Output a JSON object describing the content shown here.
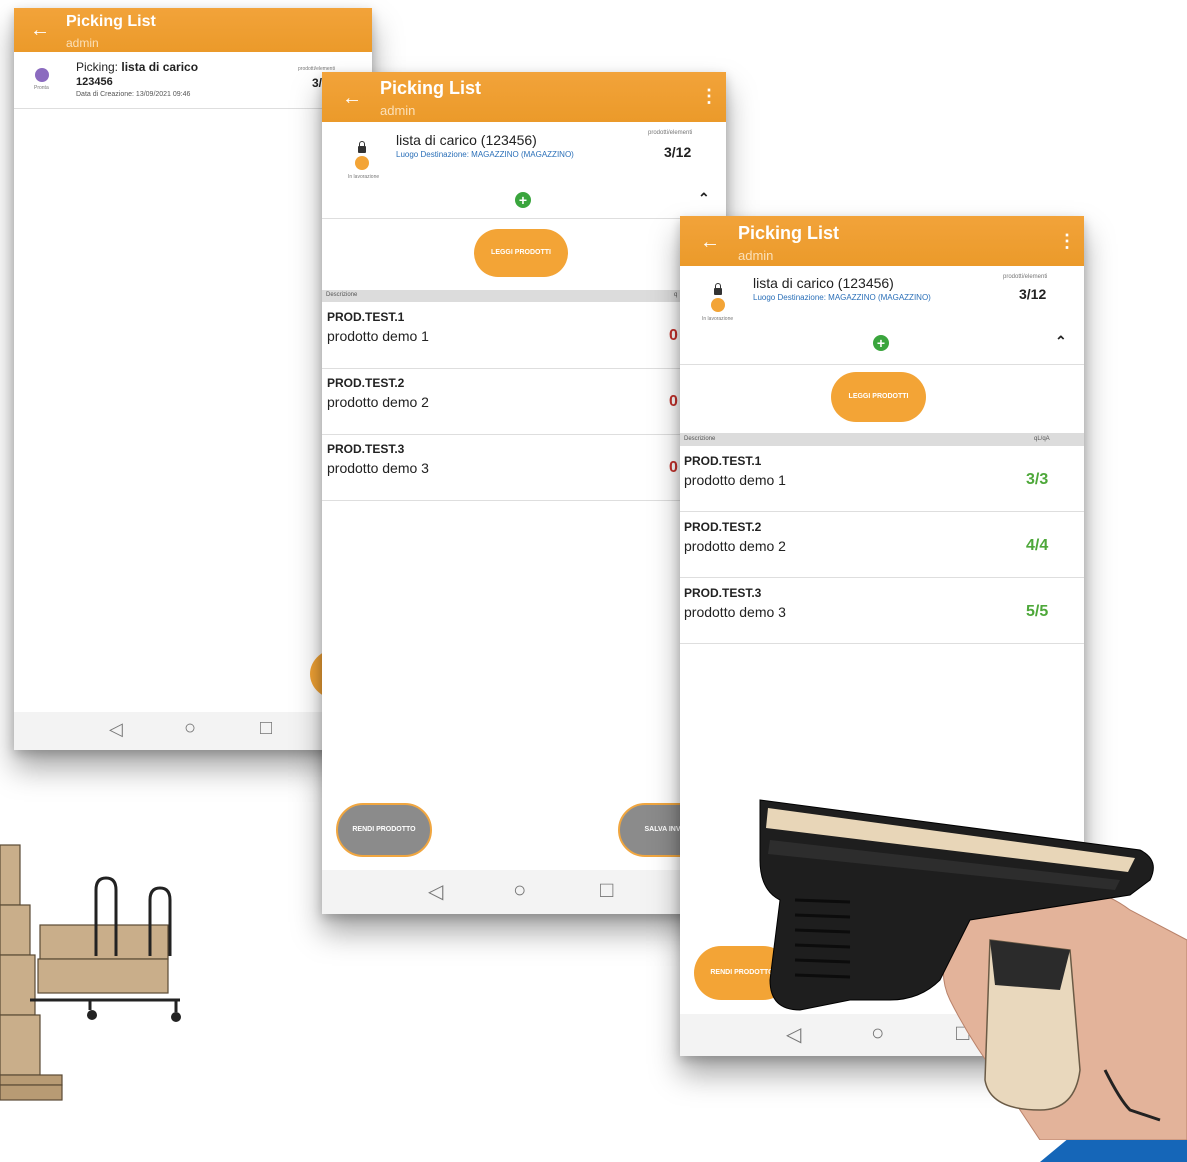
{
  "colors": {
    "accent": "#f2a33a",
    "ok": "#4ea83a",
    "warn": "#c3312c",
    "fab_green": "#3aa53d"
  },
  "screen1": {
    "title": "Picking List",
    "subtitle": "admin",
    "item": {
      "prefix": "Picking: ",
      "name": "lista di carico",
      "number": "123456",
      "date": "Data di Creazione: 13/09/2021 09:46",
      "badge": "Pronta",
      "counter_label": "prodotti/elementi",
      "counter": "3/"
    }
  },
  "screen2": {
    "title": "Picking List",
    "subtitle": "admin",
    "list_name": "lista di carico (123456)",
    "destination": "Luogo Destinazione: MAGAZZINO (MAGAZZINO)",
    "counter_label": "prodotti/elementi",
    "counter": "3/12",
    "status": "In lavorazione",
    "read_button": "LEGGI PRODOTTI",
    "col_desc": "Descrizione",
    "col_qty": "q",
    "rows": [
      {
        "code": "PROD.TEST.1",
        "desc": "prodotto demo 1",
        "qty": "0"
      },
      {
        "code": "PROD.TEST.2",
        "desc": "prodotto demo 2",
        "qty": "0"
      },
      {
        "code": "PROD.TEST.3",
        "desc": "prodotto demo 3",
        "qty": "0"
      }
    ],
    "return_button": "RENDI PRODOTTO",
    "save_button": "SALVA INVIA"
  },
  "screen3": {
    "title": "Picking List",
    "subtitle": "admin",
    "list_name": "lista di carico (123456)",
    "destination": "Luogo Destinazione: MAGAZZINO (MAGAZZINO)",
    "counter_label": "prodotti/elementi",
    "counter": "3/12",
    "status": "In lavorazione",
    "read_button": "LEGGI PRODOTTI",
    "col_desc": "Descrizione",
    "col_qty": "qL/qA",
    "rows": [
      {
        "code": "PROD.TEST.1",
        "desc": "prodotto demo 1",
        "qty": "3/3"
      },
      {
        "code": "PROD.TEST.2",
        "desc": "prodotto demo 2",
        "qty": "4/4"
      },
      {
        "code": "PROD.TEST.3",
        "desc": "prodotto demo 3",
        "qty": "5/5"
      }
    ],
    "return_button": "RENDI PRODOTTO"
  },
  "icons": {
    "back": "arrow-left-icon",
    "menu": "more-vert-icon",
    "collapse": "chevron-up-icon",
    "add": "plus-circle-icon",
    "nav_back": "triangle-back-icon",
    "nav_home": "circle-home-icon",
    "nav_recent": "square-recent-icon"
  }
}
